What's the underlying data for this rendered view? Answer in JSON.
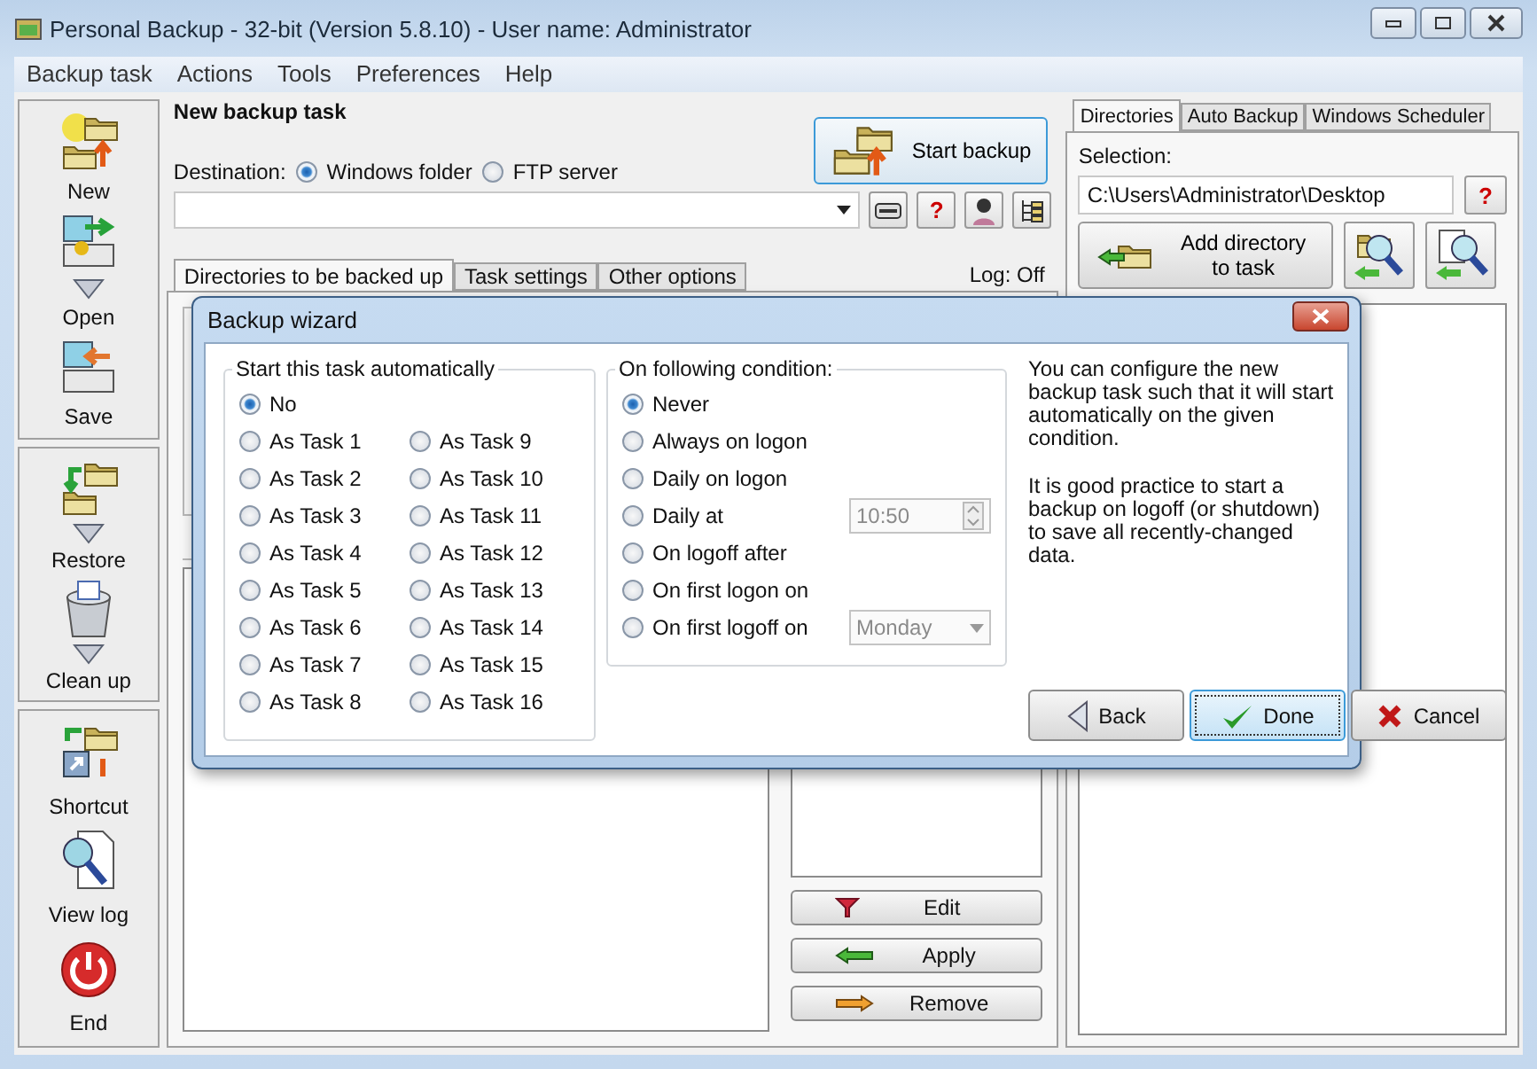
{
  "window": {
    "title": "Personal Backup - 32-bit (Version 5.8.10) - User name: Administrator"
  },
  "menu": [
    "Backup task",
    "Actions",
    "Tools",
    "Preferences",
    "Help"
  ],
  "toolbar_groups": [
    [
      {
        "label": "New",
        "kind": "new",
        "menu_arrow": false
      },
      {
        "label": "Open",
        "kind": "open",
        "menu_arrow": true
      },
      {
        "label": "Save",
        "kind": "save",
        "menu_arrow": false
      }
    ],
    [
      {
        "label": "Restore",
        "kind": "restore",
        "menu_arrow": true
      },
      {
        "label": "Clean up",
        "kind": "cleanup",
        "menu_arrow": true
      }
    ],
    [
      {
        "label": "Shortcut",
        "kind": "shortcut",
        "menu_arrow": false
      },
      {
        "label": "View log",
        "kind": "viewlog",
        "menu_arrow": false
      },
      {
        "label": "End",
        "kind": "end",
        "menu_arrow": false
      }
    ]
  ],
  "task": {
    "title": "New backup task",
    "destination_label": "Destination:",
    "destinations": [
      {
        "label": "Windows folder",
        "selected": true
      },
      {
        "label": "FTP server",
        "selected": false
      }
    ],
    "start_button": "Start backup",
    "tool_buttons": [
      {
        "kind": "drive"
      },
      {
        "kind": "help",
        "label": "?"
      },
      {
        "kind": "user"
      },
      {
        "kind": "tree"
      }
    ],
    "tabs": [
      {
        "label": "Directories to be backed up",
        "selected": true
      },
      {
        "label": "Task settings",
        "selected": false
      },
      {
        "label": "Other options",
        "selected": false
      }
    ],
    "log": "Log: Off",
    "filter_buttons": [
      {
        "label": "Edit",
        "kind": "filter"
      },
      {
        "label": "Apply",
        "kind": "left"
      },
      {
        "label": "Remove",
        "kind": "right"
      }
    ]
  },
  "right_panel": {
    "tabs": [
      {
        "label": "Directories",
        "selected": true
      },
      {
        "label": "Auto Backup",
        "selected": false
      },
      {
        "label": "Windows Scheduler",
        "selected": false
      }
    ],
    "selection_label": "Selection:",
    "selection_value": "C:\\Users\\Administrator\\Desktop",
    "help": "?",
    "add_button": [
      "Add directory",
      "to task"
    ]
  },
  "dialog": {
    "title": "Backup wizard",
    "start_group": {
      "title": "Start this task automatically",
      "options": [
        {
          "label": "No",
          "selected": true
        },
        {
          "label": "As Task 1",
          "selected": false
        },
        {
          "label": "As Task 2",
          "selected": false
        },
        {
          "label": "As Task 3",
          "selected": false
        },
        {
          "label": "As Task 4",
          "selected": false
        },
        {
          "label": "As Task 5",
          "selected": false
        },
        {
          "label": "As Task 6",
          "selected": false
        },
        {
          "label": "As Task 7",
          "selected": false
        },
        {
          "label": "As Task 8",
          "selected": false
        },
        {
          "label": "As Task 9",
          "selected": false
        },
        {
          "label": "As Task 10",
          "selected": false
        },
        {
          "label": "As Task 11",
          "selected": false
        },
        {
          "label": "As Task 12",
          "selected": false
        },
        {
          "label": "As Task 13",
          "selected": false
        },
        {
          "label": "As Task 14",
          "selected": false
        },
        {
          "label": "As Task 15",
          "selected": false
        },
        {
          "label": "As Task 16",
          "selected": false
        }
      ]
    },
    "condition_group": {
      "title": "On following condition:",
      "options": [
        {
          "label": "Never",
          "selected": true
        },
        {
          "label": "Always on logon",
          "selected": false
        },
        {
          "label": "Daily on logon",
          "selected": false
        },
        {
          "label": "Daily at",
          "selected": false,
          "field": {
            "kind": "time",
            "value": "10:50",
            "disabled": true
          }
        },
        {
          "label": "On logoff after",
          "selected": false
        },
        {
          "label": "On first logon on",
          "selected": false
        },
        {
          "label": "On first logoff on",
          "selected": false,
          "field": {
            "kind": "day",
            "value": "Monday",
            "disabled": true
          }
        }
      ]
    },
    "description": [
      "You can configure the new backup task such that it will start automatically on the given condition.",
      "It is good practice to start a backup on logoff (or shutdown) to save all recently-changed data."
    ],
    "buttons": [
      {
        "label": "Back",
        "kind": "back",
        "focused": false
      },
      {
        "label": "Done",
        "kind": "done",
        "focused": true
      },
      {
        "label": "Cancel",
        "kind": "cancel",
        "focused": false
      }
    ]
  }
}
